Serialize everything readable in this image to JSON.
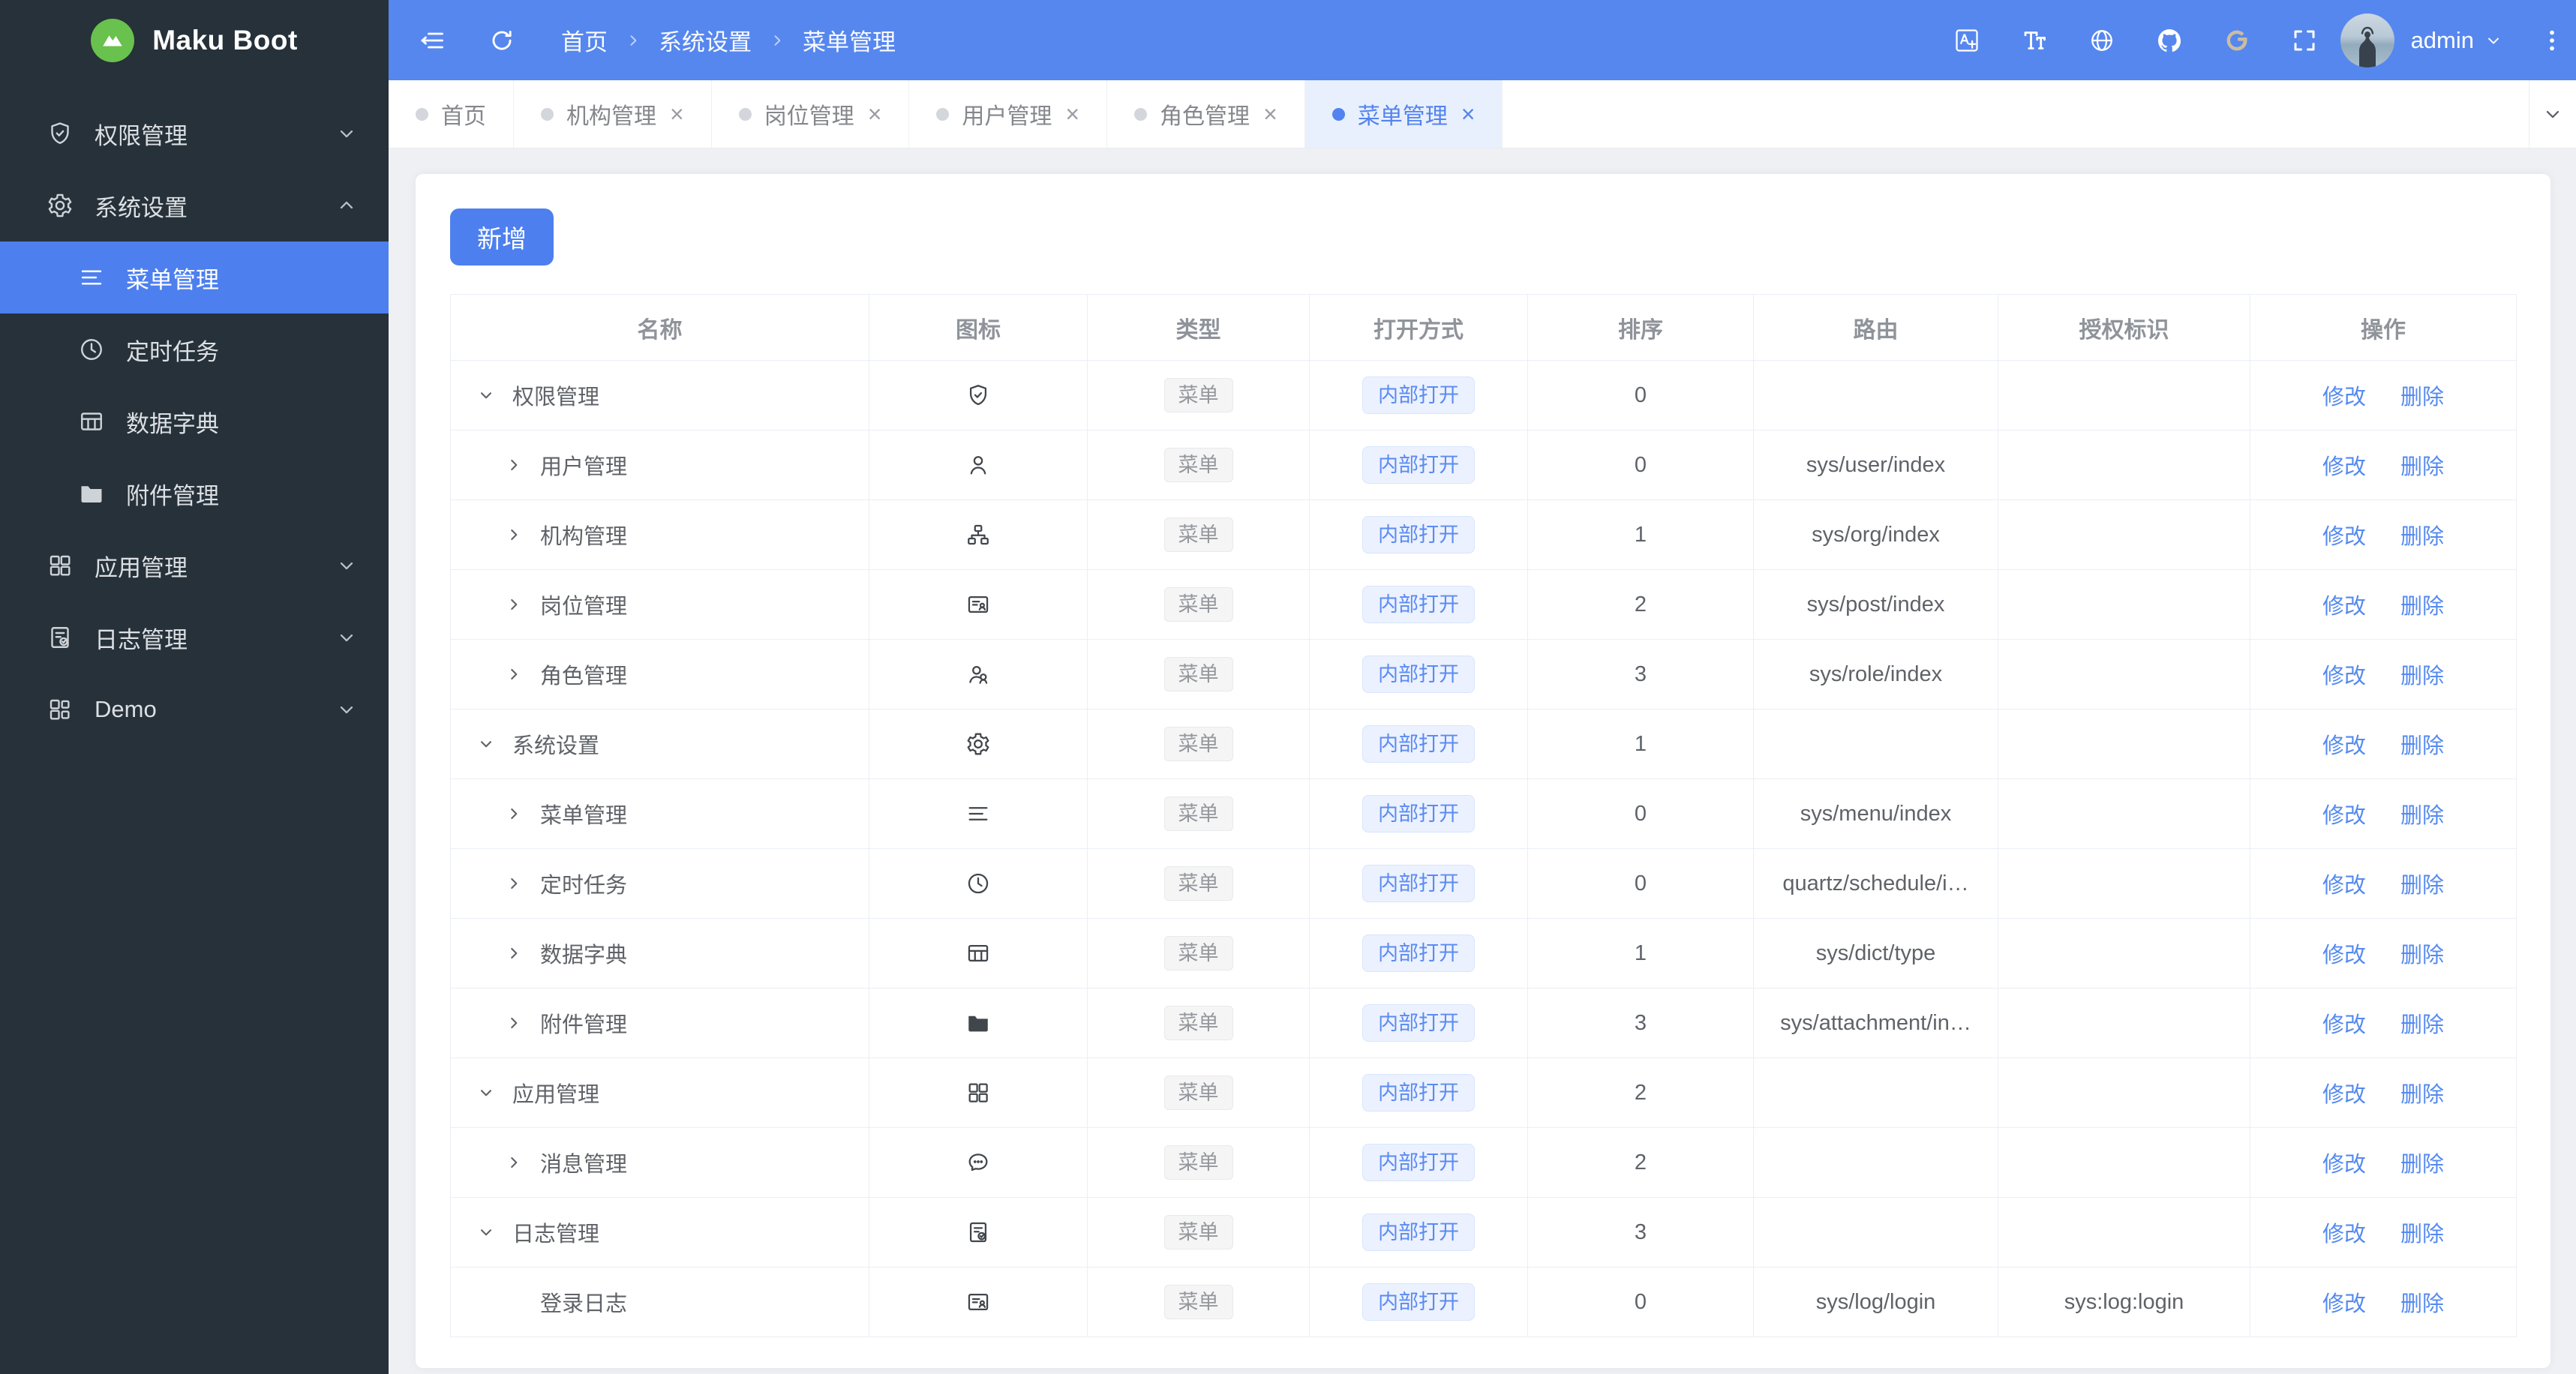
{
  "app": {
    "name": "Maku Boot",
    "logo_icon": "logo-mountain"
  },
  "colors": {
    "primary": "#4d80ee",
    "header_bg": "#5687ee",
    "sidebar_bg": "#263139",
    "active_tab_bg": "#e8f0fd",
    "link": "#548af0",
    "tag_blue_text": "#5b8bf2",
    "tag_gray_text": "#94979c",
    "logo_green": "#69c14e"
  },
  "sidebar": {
    "items": [
      {
        "label": "权限管理",
        "icon": "shield-check",
        "chevron": "chevron-down",
        "variant": "top"
      },
      {
        "label": "系统设置",
        "icon": "gear",
        "chevron": "chevron-up",
        "variant": "top"
      },
      {
        "label": "菜单管理",
        "icon": "menu-list",
        "variant": "sub",
        "active": true
      },
      {
        "label": "定时任务",
        "icon": "clock",
        "variant": "sub"
      },
      {
        "label": "数据字典",
        "icon": "dict-table",
        "variant": "sub"
      },
      {
        "label": "附件管理",
        "icon": "folder",
        "variant": "sub"
      },
      {
        "label": "应用管理",
        "icon": "app-grid",
        "chevron": "chevron-down",
        "variant": "top"
      },
      {
        "label": "日志管理",
        "icon": "log-doc",
        "chevron": "chevron-down",
        "variant": "top"
      },
      {
        "label": "Demo",
        "icon": "demo-grid",
        "chevron": "chevron-down",
        "variant": "top"
      }
    ]
  },
  "header": {
    "left_tools": [
      {
        "icon": "menu-fold",
        "variant": "menu-fold"
      },
      {
        "icon": "refresh",
        "variant": "refresh"
      }
    ],
    "breadcrumb": [
      {
        "label": "首页"
      },
      {
        "label": "系统设置"
      },
      {
        "label": "菜单管理"
      }
    ],
    "right_tools": [
      {
        "icon": "translate"
      },
      {
        "icon": "font-size"
      },
      {
        "icon": "globe"
      },
      {
        "icon": "github"
      },
      {
        "icon": "gitee",
        "variant": "gitee"
      },
      {
        "icon": "fullscreen"
      }
    ],
    "user": {
      "name": "admin",
      "chevron": "chevron-down",
      "more_icon": "more-vertical"
    }
  },
  "tabs": [
    {
      "label": "首页"
    },
    {
      "label": "机构管理",
      "closable": true
    },
    {
      "label": "岗位管理",
      "closable": true
    },
    {
      "label": "用户管理",
      "closable": true
    },
    {
      "label": "角色管理",
      "closable": true
    },
    {
      "label": "菜单管理",
      "closable": true,
      "active": true
    }
  ],
  "tabbar": {
    "dropdown_icon": "chevron-down"
  },
  "toolbar": {
    "add_label": "新增"
  },
  "table": {
    "columns": [
      {
        "label": "名称"
      },
      {
        "label": "图标"
      },
      {
        "label": "类型"
      },
      {
        "label": "打开方式"
      },
      {
        "label": "排序"
      },
      {
        "label": "路由"
      },
      {
        "label": "授权标识"
      },
      {
        "label": "操作"
      }
    ],
    "actions": {
      "edit": "修改",
      "delete": "删除"
    },
    "rows": [
      {
        "name": "权限管理",
        "expand_icon": "caret-down",
        "icon": "shield-check",
        "type": "菜单",
        "open": "内部打开",
        "sort": "0",
        "route": "",
        "auth": ""
      },
      {
        "name": "用户管理",
        "expand_icon": "caret-right",
        "icon": "user",
        "type": "菜单",
        "open": "内部打开",
        "sort": "0",
        "route": "sys/user/index",
        "auth": "",
        "variant": "child"
      },
      {
        "name": "机构管理",
        "expand_icon": "caret-right",
        "icon": "org-tree",
        "type": "菜单",
        "open": "内部打开",
        "sort": "1",
        "route": "sys/org/index",
        "auth": "",
        "variant": "child"
      },
      {
        "name": "岗位管理",
        "expand_icon": "caret-right",
        "icon": "id-card",
        "type": "菜单",
        "open": "内部打开",
        "sort": "2",
        "route": "sys/post/index",
        "auth": "",
        "variant": "child"
      },
      {
        "name": "角色管理",
        "expand_icon": "caret-right",
        "icon": "users",
        "type": "菜单",
        "open": "内部打开",
        "sort": "3",
        "route": "sys/role/index",
        "auth": "",
        "variant": "child"
      },
      {
        "name": "系统设置",
        "expand_icon": "caret-down",
        "icon": "gear",
        "type": "菜单",
        "open": "内部打开",
        "sort": "1",
        "route": "",
        "auth": ""
      },
      {
        "name": "菜单管理",
        "expand_icon": "caret-right",
        "icon": "menu-list",
        "type": "菜单",
        "open": "内部打开",
        "sort": "0",
        "route": "sys/menu/index",
        "auth": "",
        "variant": "child"
      },
      {
        "name": "定时任务",
        "expand_icon": "caret-right",
        "icon": "clock",
        "type": "菜单",
        "open": "内部打开",
        "sort": "0",
        "route": "quartz/schedule/i…",
        "auth": "",
        "variant": "child"
      },
      {
        "name": "数据字典",
        "expand_icon": "caret-right",
        "icon": "dict-table",
        "type": "菜单",
        "open": "内部打开",
        "sort": "1",
        "route": "sys/dict/type",
        "auth": "",
        "variant": "child"
      },
      {
        "name": "附件管理",
        "expand_icon": "caret-right",
        "icon": "folder",
        "type": "菜单",
        "open": "内部打开",
        "sort": "3",
        "route": "sys/attachment/in…",
        "auth": "",
        "variant": "child"
      },
      {
        "name": "应用管理",
        "expand_icon": "caret-down",
        "icon": "app-grid",
        "type": "菜单",
        "open": "内部打开",
        "sort": "2",
        "route": "",
        "auth": ""
      },
      {
        "name": "消息管理",
        "expand_icon": "caret-right",
        "icon": "chat",
        "type": "菜单",
        "open": "内部打开",
        "sort": "2",
        "route": "",
        "auth": "",
        "variant": "child"
      },
      {
        "name": "日志管理",
        "expand_icon": "caret-down",
        "icon": "log-doc",
        "type": "菜单",
        "open": "内部打开",
        "sort": "3",
        "route": "",
        "auth": ""
      },
      {
        "name": "登录日志",
        "expand_icon": "",
        "icon": "id-card",
        "type": "菜单",
        "open": "内部打开",
        "sort": "0",
        "route": "sys/log/login",
        "auth": "sys:log:login",
        "variant": "child"
      }
    ]
  }
}
